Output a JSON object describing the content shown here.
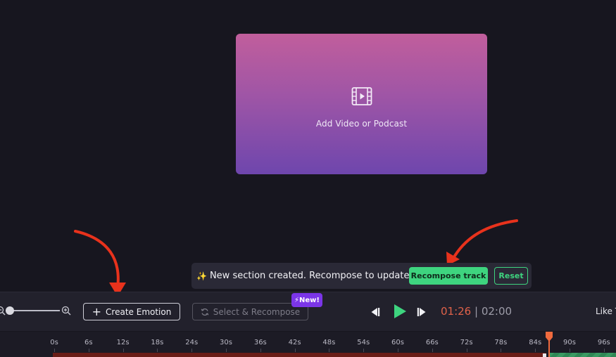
{
  "preview": {
    "add_video_label": "Add Video or Podcast",
    "gradient_top": "#c15e9c",
    "gradient_bottom": "#6e46ad",
    "icon": "film-icon"
  },
  "notification": {
    "sparkle": "✨",
    "message": "New section created. Recompose to update.",
    "recompose_label": "Recompose track",
    "reset_label": "Reset",
    "accent": "#3ed47f"
  },
  "toolbar": {
    "create_emotion_label": "Create Emotion",
    "select_recompose_label": "Select & Recompose",
    "new_badge": "⚡New!",
    "current_time": "01:26",
    "separator": " | ",
    "total_time": "02:00",
    "like_text": "Like T"
  },
  "timeline": {
    "ticks": [
      "0s",
      "6s",
      "12s",
      "18s",
      "24s",
      "30s",
      "36s",
      "42s",
      "48s",
      "54s",
      "60s",
      "66s",
      "72s",
      "78s",
      "84s",
      "90s",
      "96s"
    ]
  },
  "colors": {
    "background": "#17161f",
    "toolbar": "#22212c",
    "time_current": "#e0624a",
    "arrow": "#e8321c",
    "new_badge": "#7b35e8"
  }
}
